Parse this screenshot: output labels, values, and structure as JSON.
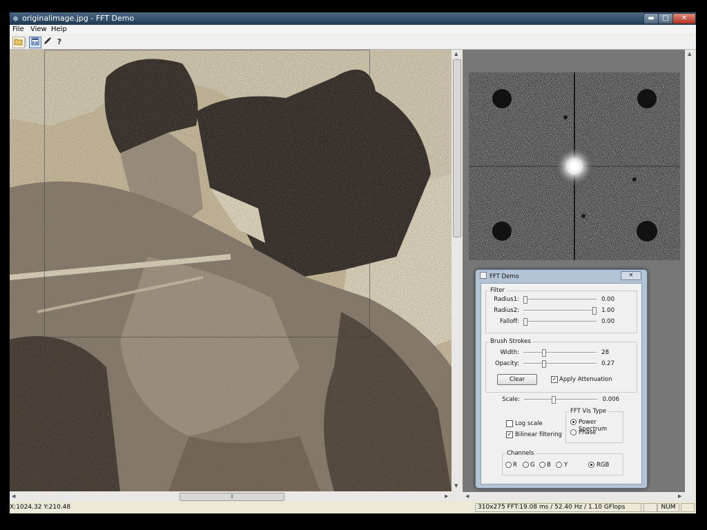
{
  "window": {
    "title": "originalimage.jpg - FFT Demo",
    "controls": {
      "minimize": "▬",
      "maximize": "□",
      "close": "✕"
    }
  },
  "menu": {
    "items": [
      "File",
      "View",
      "Help"
    ]
  },
  "toolbar": {
    "buttons": [
      {
        "name": "open-folder-icon"
      },
      {
        "name": "spectrum-view-icon"
      },
      {
        "name": "rocket-icon"
      },
      {
        "name": "help-icon",
        "label": "?"
      }
    ]
  },
  "status": {
    "coords": "X:1024.32  Y:210.48",
    "perf": "310x275 FFT:19.08 ms / 52.40 Hz / 1.10 GFlops",
    "num": "NUM"
  },
  "dialog": {
    "title": "FFT Demo",
    "close": "✕",
    "filter": {
      "title": "Filter",
      "radius1": {
        "label": "Radius1:",
        "value": "0.00",
        "level": 0.0
      },
      "radius2": {
        "label": "Radius2:",
        "value": "1.00",
        "level": 1.0
      },
      "falloff": {
        "label": "Falloff:",
        "value": "0.00",
        "level": 0.0
      }
    },
    "brush": {
      "title": "Brush Strokes",
      "width": {
        "label": "Width:",
        "value": "28",
        "level": 0.27
      },
      "opacity": {
        "label": "Opacity:",
        "value": "0.27",
        "level": 0.27
      },
      "clear": "Clear",
      "apply_attenuation": {
        "label": "Apply Attenuation",
        "checked": true
      }
    },
    "scale": {
      "label": "Scale:",
      "value": "0.006",
      "level": 0.4
    },
    "log_scale": {
      "label": "Log scale",
      "checked": false
    },
    "bilinear": {
      "label": "Bilinear filtering",
      "checked": true
    },
    "vis_type": {
      "title": "FFT Vis Type",
      "options": [
        "Power Spectrum",
        "Phase"
      ],
      "selected": "Power Spectrum"
    },
    "channels": {
      "title": "Channels",
      "options": [
        "R",
        "G",
        "B",
        "Y",
        "RGB"
      ],
      "selected": "RGB"
    }
  },
  "colors": {
    "titlebar": "#2a4560",
    "photo_tint": "#c8bda6",
    "dialog_frame": "#b3c4d6",
    "right_pane": "#777777"
  }
}
